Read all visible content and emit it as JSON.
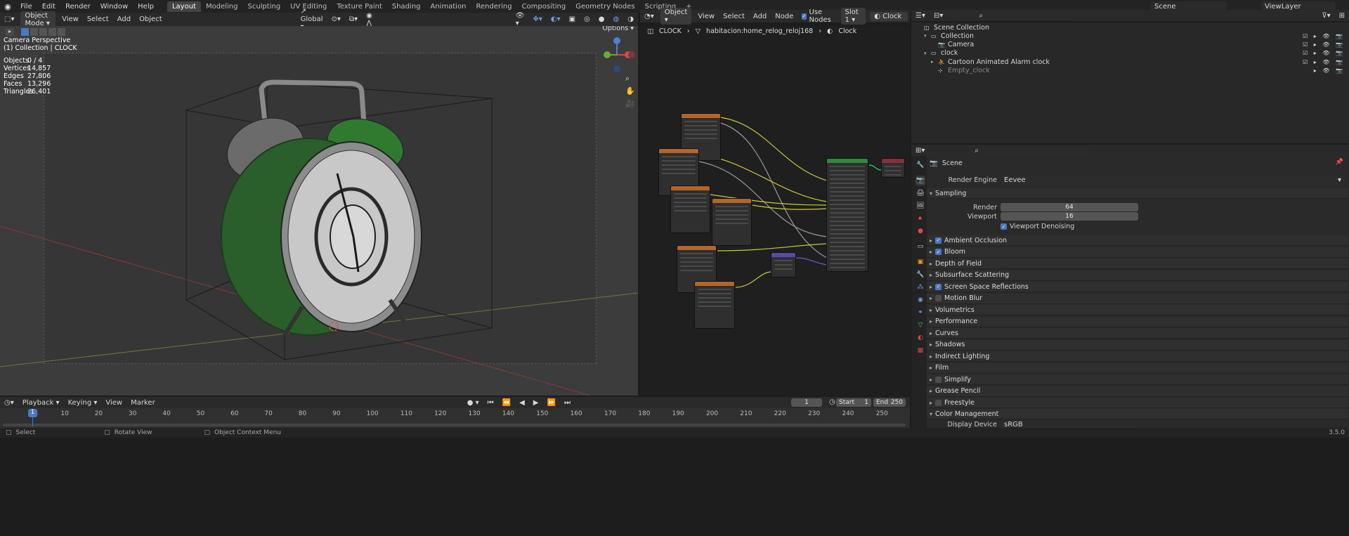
{
  "topbar": {
    "menu": [
      "File",
      "Edit",
      "Render",
      "Window",
      "Help"
    ],
    "workspaces": [
      "Layout",
      "Modeling",
      "Sculpting",
      "UV Editing",
      "Texture Paint",
      "Shading",
      "Animation",
      "Rendering",
      "Compositing",
      "Geometry Nodes",
      "Scripting"
    ],
    "active_workspace": "Layout",
    "scene": "Scene",
    "view_layer": "ViewLayer"
  },
  "viewport": {
    "mode": "Object Mode",
    "menu": [
      "View",
      "Select",
      "Add",
      "Object"
    ],
    "orientation": "Global",
    "options_label": "Options",
    "camera_label": "Camera Perspective",
    "collection_label": "(1) Collection | CLOCK",
    "stats": [
      {
        "label": "Objects",
        "value": "0 / 4"
      },
      {
        "label": "Vertices",
        "value": "14,857"
      },
      {
        "label": "Edges",
        "value": "27,806"
      },
      {
        "label": "Faces",
        "value": "13,296"
      },
      {
        "label": "Triangles",
        "value": "26,401"
      }
    ]
  },
  "node_editor": {
    "type": "Object",
    "menu": [
      "View",
      "Select",
      "Add",
      "Node"
    ],
    "use_nodes_label": "Use Nodes",
    "slot": "Slot 1",
    "material": "Clock",
    "breadcrumb": [
      "CLOCK",
      "habitacion:home_relog_reloj168",
      "Clock"
    ]
  },
  "timeline": {
    "menu": [
      "Playback",
      "Keying",
      "View",
      "Marker"
    ],
    "current_frame": "1",
    "start_label": "Start",
    "start": "1",
    "end_label": "End",
    "end": "250",
    "ticks": [
      "10",
      "20",
      "30",
      "40",
      "50",
      "60",
      "70",
      "80",
      "90",
      "100",
      "110",
      "120",
      "130",
      "140",
      "150",
      "160",
      "170",
      "180",
      "190",
      "200",
      "210",
      "220",
      "230",
      "240",
      "250"
    ],
    "playhead": "1"
  },
  "status": {
    "select": "Select",
    "rotate": "Rotate View",
    "context": "Object Context Menu",
    "version": "3.5.0"
  },
  "outliner": {
    "rows": [
      {
        "label": "Scene Collection",
        "indent": 0
      },
      {
        "label": "Collection",
        "indent": 1
      },
      {
        "label": "Camera",
        "indent": 2
      },
      {
        "label": "clock",
        "indent": 1
      },
      {
        "label": "Cartoon Animated  Alarm clock",
        "indent": 2
      },
      {
        "label": "Empty_clock",
        "indent": 2
      }
    ]
  },
  "properties": {
    "context": "Scene",
    "render_engine_label": "Render Engine",
    "render_engine": "Eevee",
    "sampling_label": "Sampling",
    "render_label": "Render",
    "render_value": "64",
    "viewport_label": "Viewport",
    "viewport_value": "16",
    "denoise_label": "Viewport Denoising",
    "panels": [
      {
        "label": "Ambient Occlusion",
        "check": true
      },
      {
        "label": "Bloom",
        "check": true
      },
      {
        "label": "Depth of Field",
        "check": null
      },
      {
        "label": "Subsurface Scattering",
        "check": null
      },
      {
        "label": "Screen Space Reflections",
        "check": true
      },
      {
        "label": "Motion Blur",
        "check": false
      },
      {
        "label": "Volumetrics",
        "check": null
      },
      {
        "label": "Performance",
        "check": null
      },
      {
        "label": "Curves",
        "check": null
      },
      {
        "label": "Shadows",
        "check": null
      },
      {
        "label": "Indirect Lighting",
        "check": null
      },
      {
        "label": "Film",
        "check": null
      },
      {
        "label": "Simplify",
        "check": false
      },
      {
        "label": "Grease Pencil",
        "check": null
      },
      {
        "label": "Freestyle",
        "check": false
      }
    ],
    "color_mgmt_label": "Color Management",
    "display_device_label": "Display Device",
    "display_device": "sRGB"
  },
  "colors": {
    "accent": "#4a78c4",
    "selected": "#f59b2a",
    "clock_green": "#2f8a2f"
  }
}
